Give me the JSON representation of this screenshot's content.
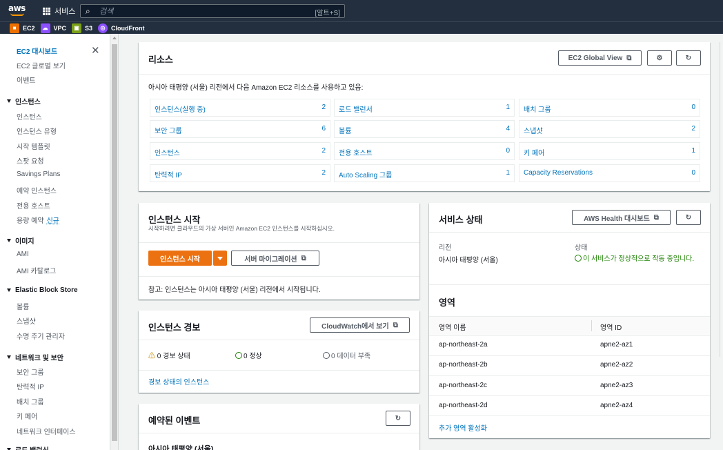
{
  "topbar": {
    "logo": "aws",
    "services_label": "서비스",
    "search_placeholder": "검색",
    "search_shortcut": "[알트+S]"
  },
  "favorites": [
    {
      "label": "EC2",
      "icon": "ec2-icon",
      "color": "#ed7100"
    },
    {
      "label": "VPC",
      "icon": "vpc-icon",
      "color": "#8c4fff"
    },
    {
      "label": "S3",
      "icon": "s3-icon",
      "color": "#7aa116"
    },
    {
      "label": "CloudFront",
      "icon": "cloudfront-icon",
      "color": "#8c4fff"
    }
  ],
  "sidebar": {
    "top_items": [
      "EC2 대시보드",
      "EC2 글로벌 보기",
      "이벤트"
    ],
    "sections": [
      {
        "title": "인스턴스",
        "items": [
          "인스턴스",
          "인스턴스 유형",
          "시작 템플릿",
          "스팟 요청",
          "Savings Plans",
          "예약 인스턴스",
          "전용 호스트",
          "용량 예약"
        ]
      },
      {
        "title": "이미지",
        "items": [
          "AMI",
          "AMI 카탈로그"
        ]
      },
      {
        "title": "Elastic Block Store",
        "items": [
          "볼륨",
          "스냅샷",
          "수명 주기 관리자"
        ]
      },
      {
        "title": "네트워크 및 보안",
        "items": [
          "보안 그룹",
          "탄력적 IP",
          "배치 그룹",
          "키 페어",
          "네트워크 인터페이스"
        ]
      },
      {
        "title": "로드 밸런싱",
        "items": []
      }
    ],
    "new_badge": "신규"
  },
  "resources": {
    "title": "리소스",
    "global_view_btn": "EC2 Global View",
    "description": "아시아 태평양 (서울) 리전에서 다음 Amazon EC2 리소스를 사용하고 있음:",
    "items": [
      {
        "label": "인스턴스(실행 중)",
        "count": "2"
      },
      {
        "label": "로드 밸런서",
        "count": "1"
      },
      {
        "label": "배치 그룹",
        "count": "0"
      },
      {
        "label": "보안 그룹",
        "count": "6"
      },
      {
        "label": "볼륨",
        "count": "4"
      },
      {
        "label": "스냅샷",
        "count": "2"
      },
      {
        "label": "인스턴스",
        "count": "2"
      },
      {
        "label": "전용 호스트",
        "count": "0"
      },
      {
        "label": "키 페어",
        "count": "1"
      },
      {
        "label": "탄력적 IP",
        "count": "2"
      },
      {
        "label": "Auto Scaling 그룹",
        "count": "1"
      },
      {
        "label": "Capacity Reservations",
        "count": "0"
      }
    ]
  },
  "launch": {
    "title": "인스턴스 시작",
    "subtitle": "시작하려면 클라우드의 가상 서버인 Amazon EC2 인스턴스를 시작하십시오.",
    "launch_btn": "인스턴스 시작",
    "migrate_btn": "서버 마이그레이션",
    "note": "참고: 인스턴스는 아시아 태평양 (서울) 리전에서 시작됩니다."
  },
  "alarms": {
    "title": "인스턴스 경보",
    "cloudwatch_btn": "CloudWatch에서 보기",
    "alarm_state": "0 경보 상태",
    "ok_state": "0 정상",
    "insufficient_state": "0 데이터 부족",
    "link": "경보 상태의 인스턴스"
  },
  "events": {
    "title": "예약된 이벤트",
    "region": "아시아 태평양 (서울)"
  },
  "health": {
    "title": "서비스 상태",
    "health_btn": "AWS Health 대시보드",
    "region_label": "리전",
    "region_value": "아시아 태평양 (서울)",
    "status_label": "상태",
    "status_value": "이 서비스가 정상적으로 작동 중입니다."
  },
  "zones": {
    "title": "영역",
    "col_name": "영역 이름",
    "col_id": "영역 ID",
    "rows": [
      {
        "name": "ap-northeast-2a",
        "id": "apne2-az1"
      },
      {
        "name": "ap-northeast-2b",
        "id": "apne2-az2"
      },
      {
        "name": "ap-northeast-2c",
        "id": "apne2-az3"
      },
      {
        "name": "ap-northeast-2d",
        "id": "apne2-az4"
      }
    ],
    "enable_link": "추가 영역 활성화"
  }
}
